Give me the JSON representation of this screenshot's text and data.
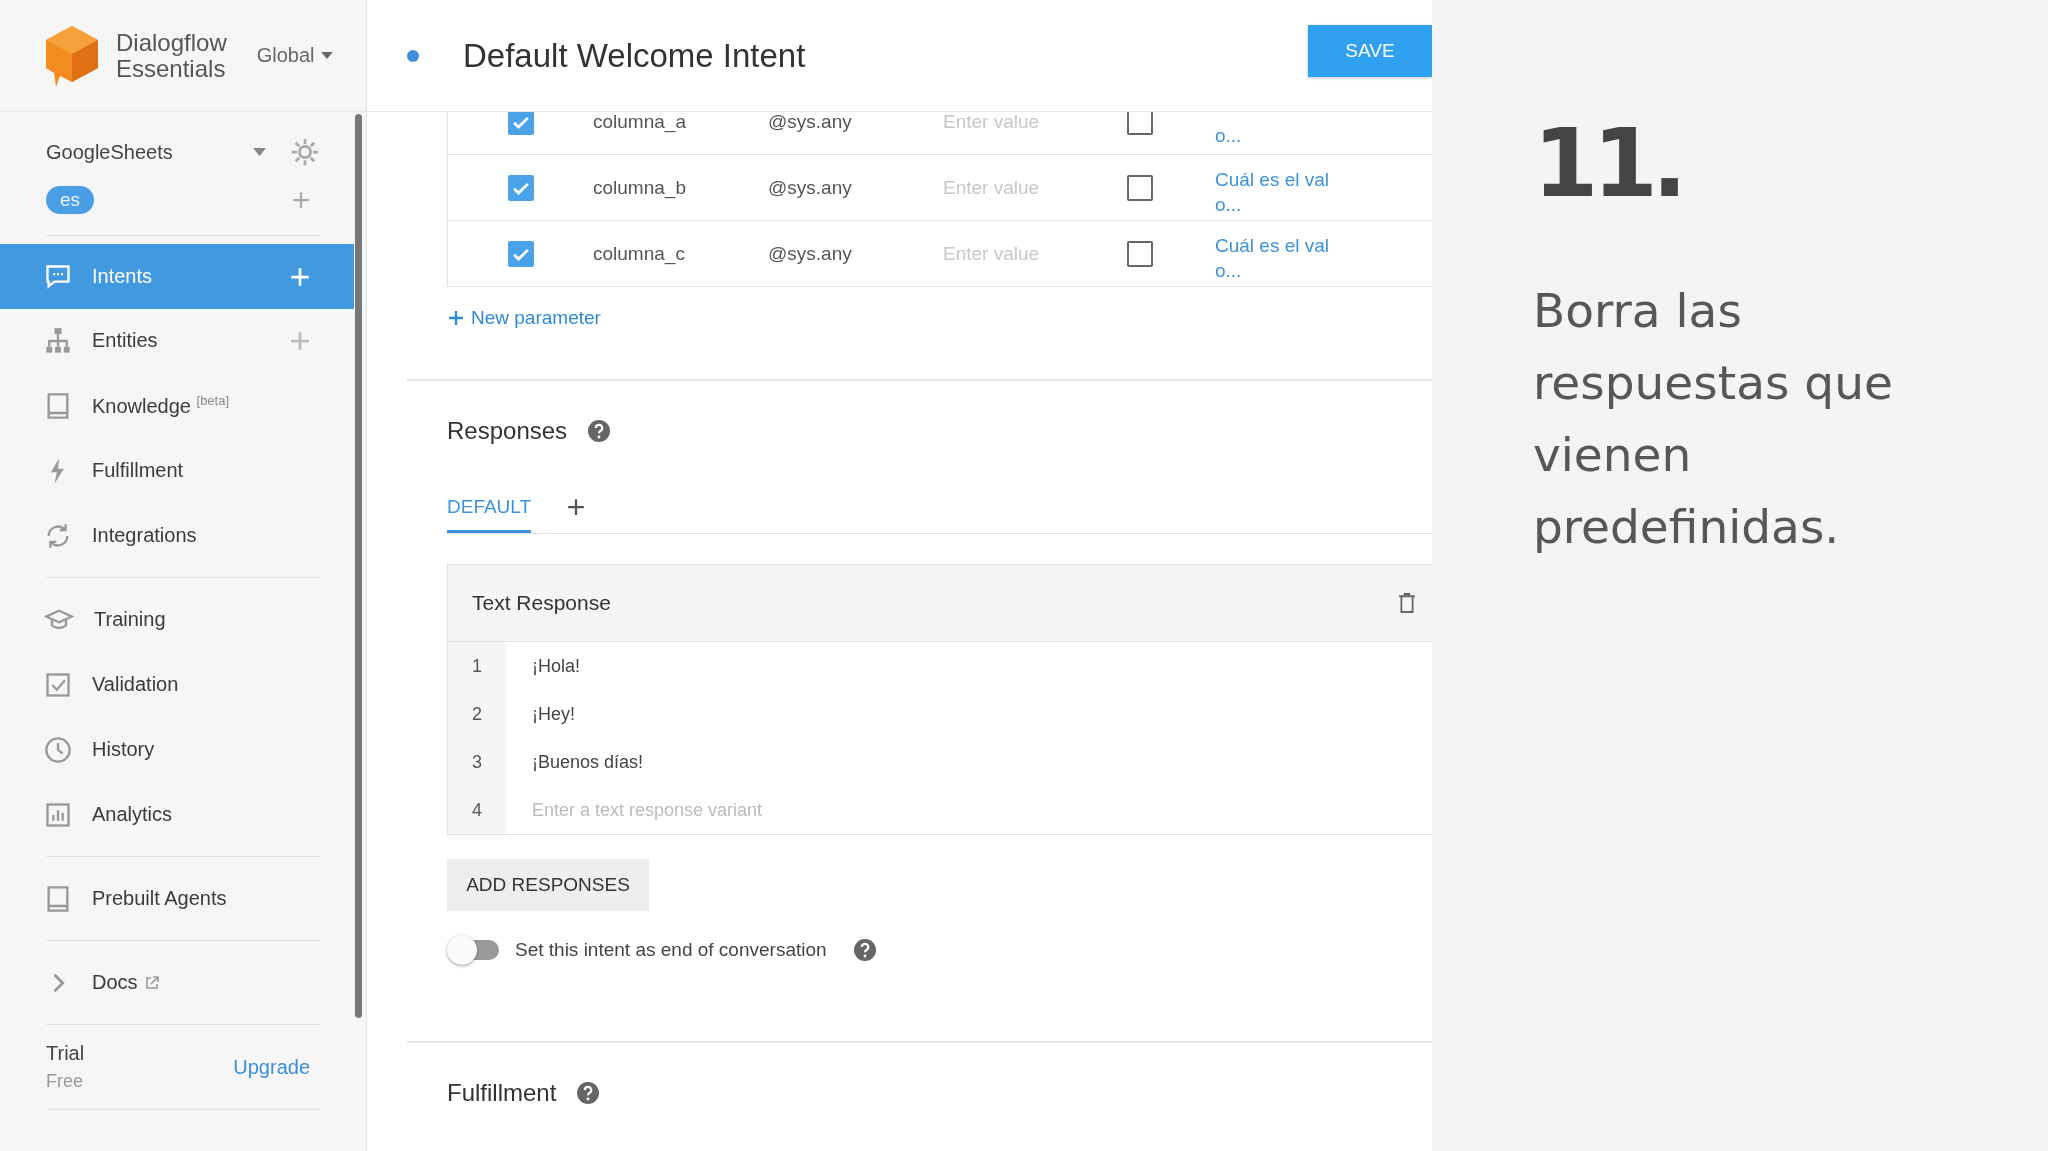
{
  "sidebar": {
    "logo_line1": "Dialogflow",
    "logo_line2": "Essentials",
    "region": "Global",
    "agent": "GoogleSheets",
    "language": "es",
    "nav_groups": [
      [
        {
          "label": "Intents",
          "selected": true,
          "add": true,
          "external": false
        },
        {
          "label": "Entities",
          "selected": false,
          "add": true,
          "external": false
        },
        {
          "label": "Knowledge $^{[beta]}$",
          "selected": false,
          "add": false,
          "external": false
        },
        {
          "label": "Fulfillment",
          "selected": false,
          "add": false,
          "external": false
        },
        {
          "label": "Integrations",
          "selected": false,
          "add": false,
          "external": false
        }
      ],
      [
        {
          "label": "Training",
          "selected": false,
          "add": false,
          "external": false
        },
        {
          "label": "Validation",
          "selected": false,
          "add": false,
          "external": false
        },
        {
          "label": "History",
          "selected": false,
          "add": false,
          "external": false
        },
        {
          "label": "Analytics",
          "selected": false,
          "add": false,
          "external": false
        }
      ],
      [
        {
          "label": "Prebuilt Agents",
          "selected": false,
          "add": false,
          "external": false
        }
      ],
      [
        {
          "label": "Docs",
          "selected": false,
          "add": false,
          "external": true
        }
      ]
    ],
    "plan": {
      "name": "Trial",
      "tier": "Free",
      "upgrade": "Upgrade"
    }
  },
  "header": {
    "title": "Default Welcome Intent",
    "unsaved": true,
    "save": "SAVE"
  },
  "parameters": {
    "rows": [
      {
        "required": true,
        "name": "columna_a",
        "entity": "@sys.any",
        "value_placeholder": "Enter value",
        "is_list": false,
        "prompt": [
          "o..."
        ]
      },
      {
        "required": true,
        "name": "columna_b",
        "entity": "@sys.any",
        "value_placeholder": "Enter value",
        "is_list": false,
        "prompt": [
          "Cuál es el val",
          "o..."
        ]
      },
      {
        "required": true,
        "name": "columna_c",
        "entity": "@sys.any",
        "value_placeholder": "Enter value",
        "is_list": false,
        "prompt": [
          "Cuál es el val",
          "o..."
        ]
      }
    ],
    "new": "New parameter"
  },
  "responses": {
    "title": "Responses",
    "tabs": [
      {
        "label": "DEFAULT",
        "selected": true
      }
    ],
    "card_title": "Text Response",
    "variants": [
      {
        "number": "1",
        "text": "¡Hola!"
      },
      {
        "number": "2",
        "text": "¡Hey!"
      },
      {
        "number": "3",
        "text": "¡Buenos días!"
      },
      {
        "number": "4",
        "placeholder": "Enter a text response variant"
      }
    ],
    "add_button": "ADD RESPONSES",
    "end_toggle": {
      "label": "Set this intent as end of conversation",
      "on": false
    }
  },
  "fulfillment": {
    "title": "Fulfillment"
  },
  "overlay": {
    "step": "11.",
    "text": "Borra las respuestas que vienen predefinidas."
  }
}
